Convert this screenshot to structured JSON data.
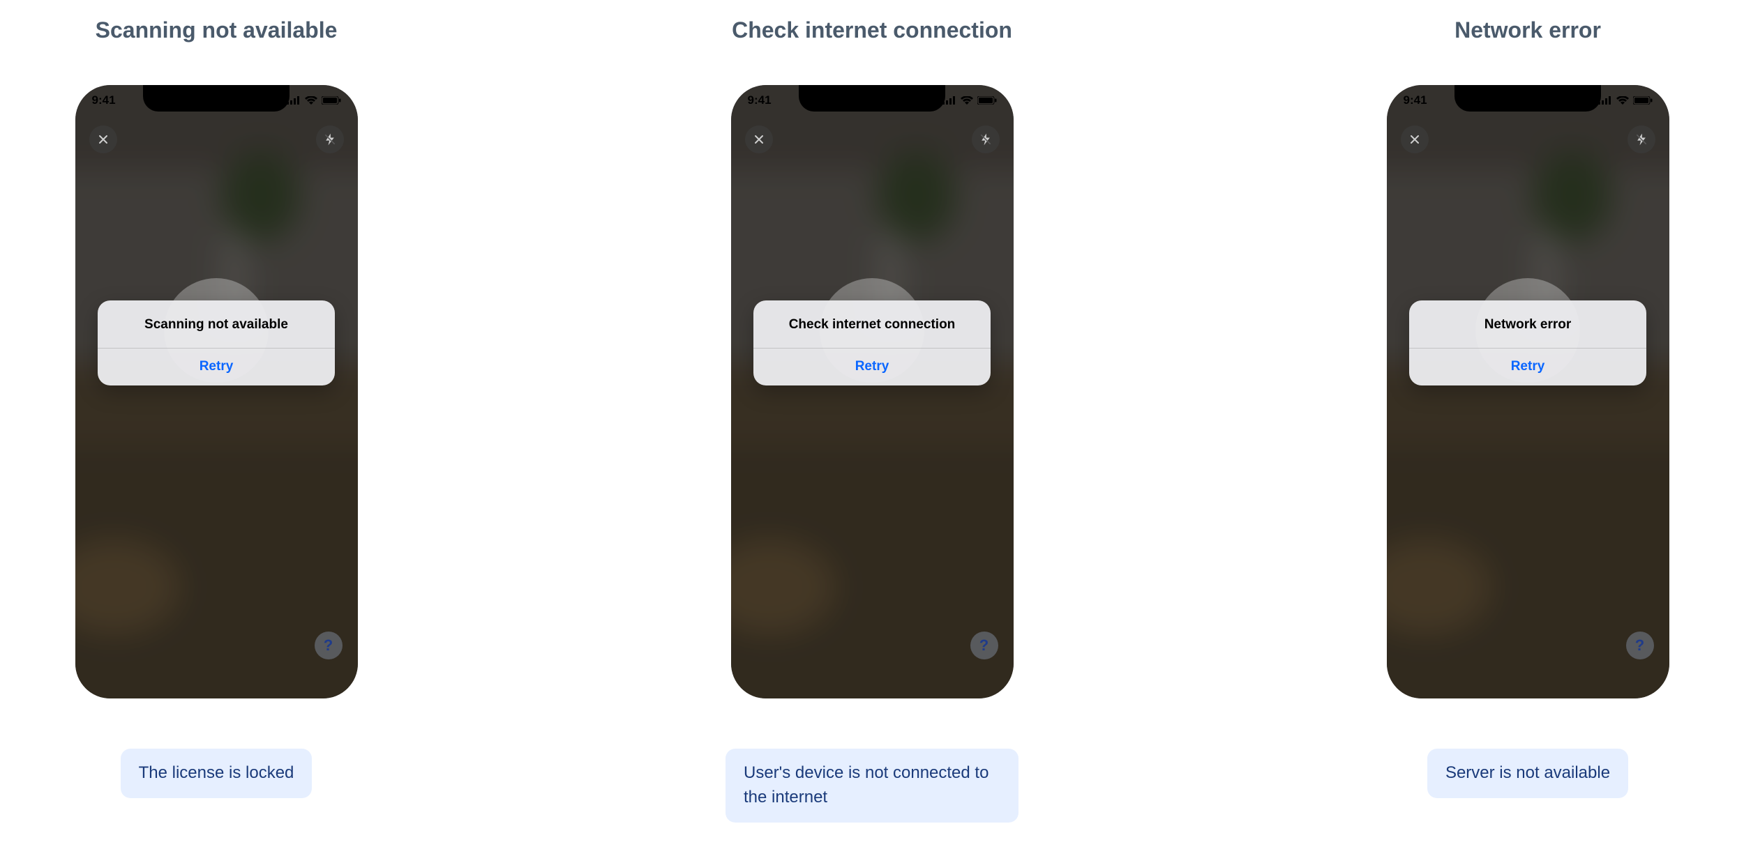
{
  "status_bar": {
    "time": "9:41"
  },
  "overlay": {
    "close_icon_name": "close-icon",
    "flash_icon_name": "flash-off-icon",
    "help_glyph": "?"
  },
  "columns": [
    {
      "heading": "Scanning not available",
      "alert_title": "Scanning not available",
      "alert_action": "Retry",
      "caption": "The license is locked"
    },
    {
      "heading": "Check internet connection",
      "alert_title": "Check internet connection",
      "alert_action": "Retry",
      "caption": "User's device is not connected to the internet"
    },
    {
      "heading": "Network error",
      "alert_title": "Network error",
      "alert_action": "Retry",
      "caption": "Server is not available"
    }
  ]
}
